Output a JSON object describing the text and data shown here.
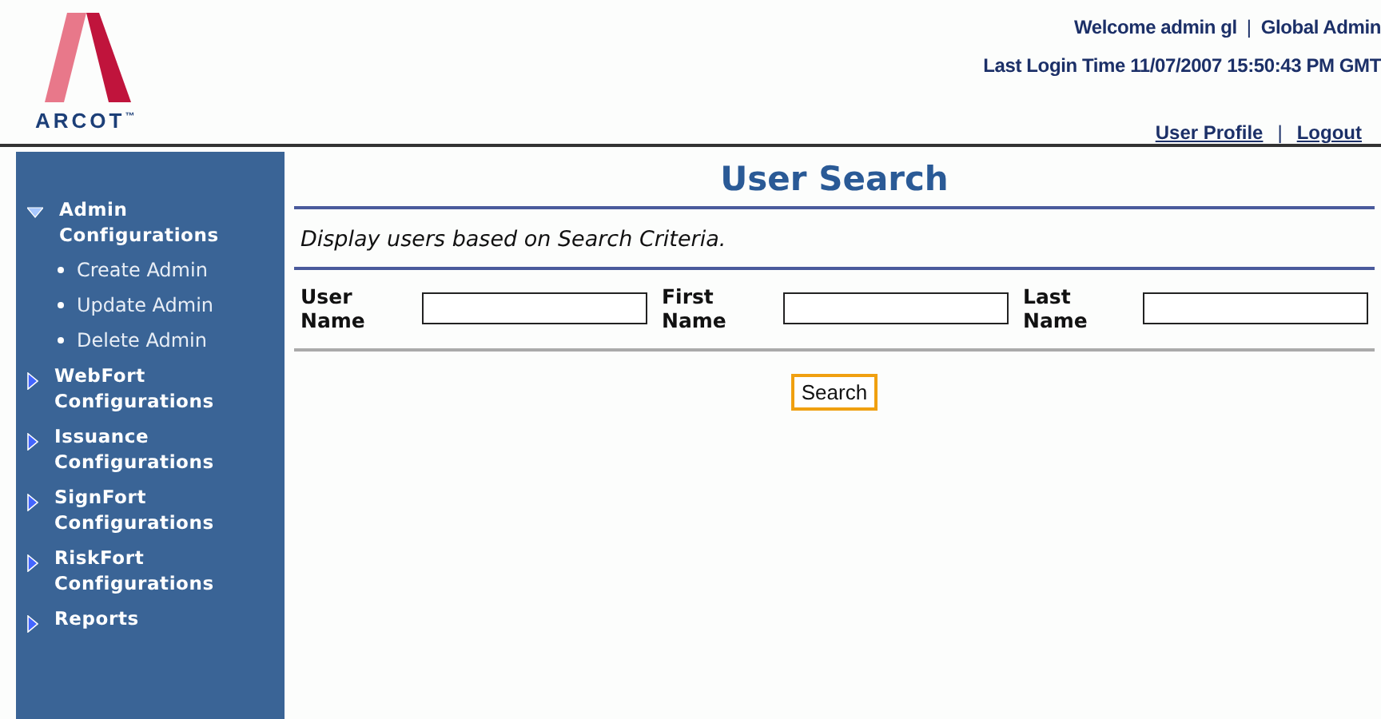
{
  "header": {
    "logo_text": "ARCOT",
    "trademark": "™",
    "welcome": "Welcome admin  gl",
    "separator": "|",
    "role": "Global Admin",
    "last_login": "Last Login Time 11/07/2007 15:50:43 PM GMT",
    "links": [
      {
        "label": "User Profile"
      },
      {
        "label": "Logout"
      }
    ],
    "link_separator": "|"
  },
  "sidebar": {
    "items": [
      {
        "label": "Admin Configurations",
        "expanded": true,
        "children": [
          {
            "label": "Create Admin"
          },
          {
            "label": "Update Admin"
          },
          {
            "label": "Delete Admin"
          }
        ]
      },
      {
        "label": "WebFort Configurations",
        "expanded": false
      },
      {
        "label": "Issuance Configurations",
        "expanded": false
      },
      {
        "label": "SignFort Configurations",
        "expanded": false
      },
      {
        "label": "RiskFort Configurations",
        "expanded": false
      },
      {
        "label": "Reports",
        "expanded": false
      }
    ]
  },
  "page": {
    "title": "User Search",
    "description": "Display users based on Search Criteria.",
    "fields": [
      {
        "label": "User Name"
      },
      {
        "label": "First Name"
      },
      {
        "label": "Last Name"
      }
    ],
    "button": "Search"
  }
}
